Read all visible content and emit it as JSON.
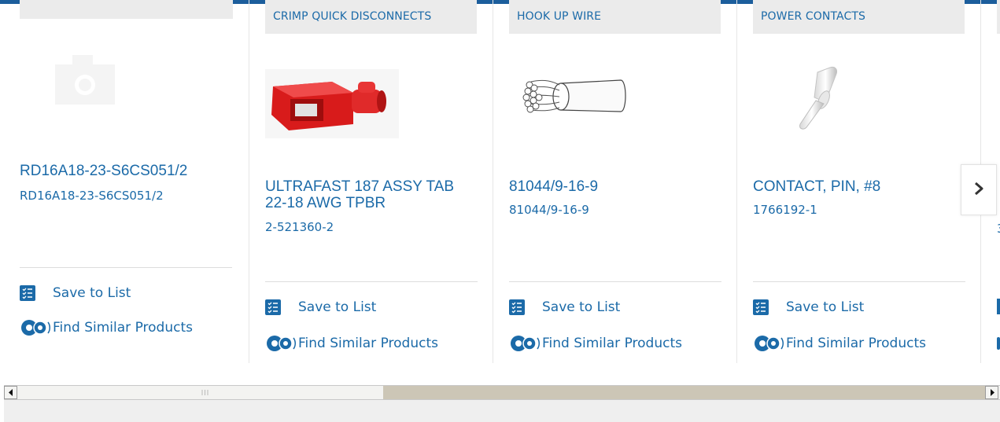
{
  "cards": [
    {
      "category": "",
      "title": "RD16A18-23-S6CS051/2",
      "part_number": "RD16A18-23-S6CS051/2",
      "image": "camera-placeholder-icon",
      "save_label": "Save to List",
      "similar_label": "Find Similar Products"
    },
    {
      "category": "CRIMP QUICK DISCONNECTS",
      "title": "ULTRAFAST 187 ASSY TAB 22-18 AWG TPBR",
      "part_number": "2-521360-2",
      "image": "red-quick-disconnect-image",
      "save_label": "Save to List",
      "similar_label": "Find Similar Products"
    },
    {
      "category": "HOOK UP WIRE",
      "title": "81044/9-16-9",
      "part_number": "81044/9-16-9",
      "image": "stranded-wire-image",
      "save_label": "Save to List",
      "similar_label": "Find Similar Products"
    },
    {
      "category": "POWER CONTACTS",
      "title": "CONTACT, PIN, #8",
      "part_number": "1766192-1",
      "image": "pin-contact-image",
      "save_label": "Save to List",
      "similar_label": "Find Similar Products"
    }
  ],
  "partial_card": {
    "part_number_fragment": "3"
  },
  "next_button": {
    "icon": "chevron-right-icon"
  },
  "colors": {
    "link": "#1b6aa8",
    "topbar": "#1c5e9c",
    "accent": "#f08a1c",
    "category_bg": "#ebebeb"
  }
}
